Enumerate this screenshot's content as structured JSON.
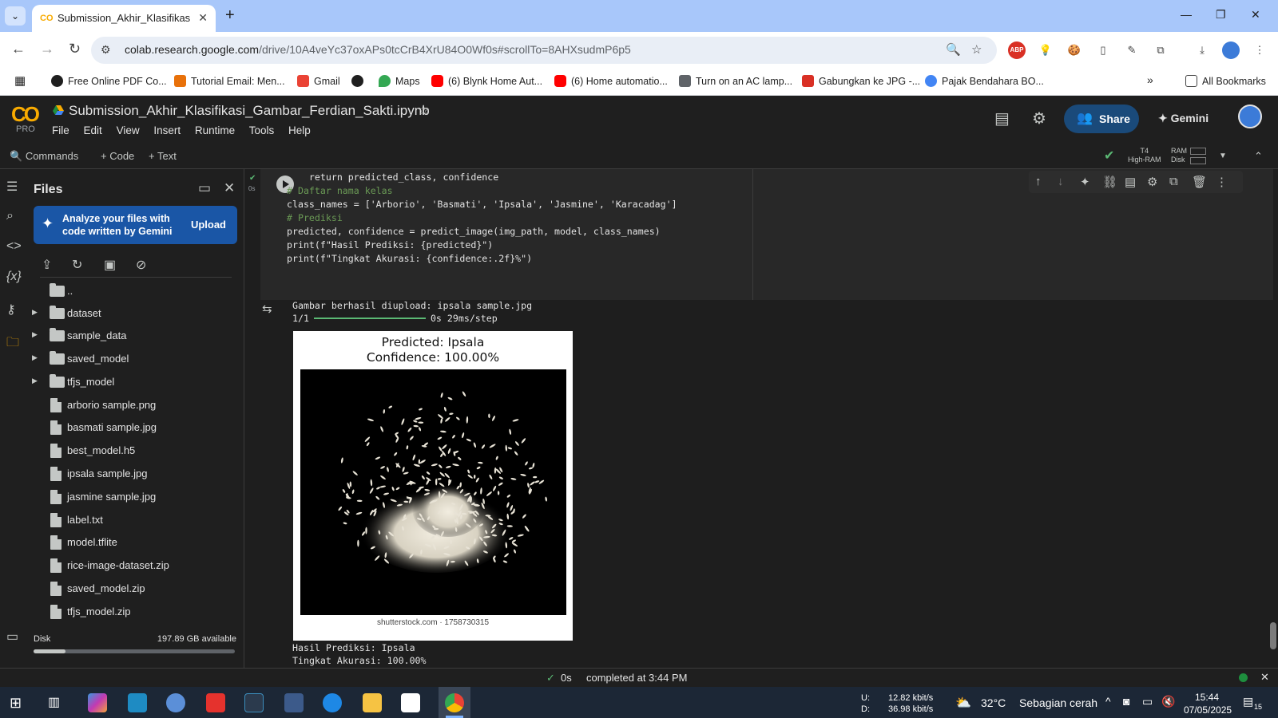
{
  "browser": {
    "tab_title": "Submission_Akhir_Klasifikasi_Ga",
    "url_host": "colab.research.google.com",
    "url_path": "/drive/10A4veYc37oxAPs0tcCrB4XrU84O0Wf0s#scrollTo=8AHXsudmP6p5",
    "bookmarks": [
      {
        "label": "Free Online PDF Co...",
        "color": "#1f1f1f"
      },
      {
        "label": "Tutorial Email: Men...",
        "color": "#e8710a"
      },
      {
        "label": "Gmail",
        "color": "#ea4335"
      },
      {
        "label": "",
        "color": "#1f1f1f"
      },
      {
        "label": "Maps",
        "color": "#34a853"
      },
      {
        "label": "(6) Blynk Home Aut...",
        "color": "#ff0000"
      },
      {
        "label": "(6) Home automatio...",
        "color": "#ff0000"
      },
      {
        "label": "Turn on an AC lamp...",
        "color": "#5f6368"
      },
      {
        "label": "Gabungkan ke JPG -...",
        "color": "#d93025"
      },
      {
        "label": "Pajak Bendahara BO...",
        "color": "#4285f4"
      }
    ],
    "all_bookmarks": "All Bookmarks"
  },
  "colab": {
    "logo": "CO",
    "tier": "PRO",
    "notebook_title": "Submission_Akhir_Klasifikasi_Gambar_Ferdian_Sakti.ipynb",
    "menu": [
      "File",
      "Edit",
      "View",
      "Insert",
      "Runtime",
      "Tools",
      "Help"
    ],
    "share_label": "Share",
    "gemini_label": "Gemini",
    "commands_label": "Commands",
    "code_label": "+ Code",
    "text_label": "+ Text",
    "runtime_gpu": "T4",
    "runtime_type": "High-RAM",
    "ram_label": "RAM",
    "disk_label": "Disk"
  },
  "files_panel": {
    "title": "Files",
    "gemini_prompt": "Analyze your files with code written by Gemini",
    "upload_label": "Upload",
    "items": [
      {
        "label": "..",
        "type": "parent"
      },
      {
        "label": "dataset",
        "type": "folder"
      },
      {
        "label": "sample_data",
        "type": "folder"
      },
      {
        "label": "saved_model",
        "type": "folder"
      },
      {
        "label": "tfjs_model",
        "type": "folder"
      },
      {
        "label": "arborio sample.png",
        "type": "file"
      },
      {
        "label": "basmati sample.jpg",
        "type": "file"
      },
      {
        "label": "best_model.h5",
        "type": "file"
      },
      {
        "label": "ipsala sample.jpg",
        "type": "file"
      },
      {
        "label": "jasmine sample.jpg",
        "type": "file"
      },
      {
        "label": "label.txt",
        "type": "file"
      },
      {
        "label": "model.tflite",
        "type": "file"
      },
      {
        "label": "rice-image-dataset.zip",
        "type": "file"
      },
      {
        "label": "saved_model.zip",
        "type": "file"
      },
      {
        "label": "tfjs_model.zip",
        "type": "file"
      }
    ],
    "disk_label": "Disk",
    "disk_available": "197.89 GB available",
    "disk_used_fraction": 0.16
  },
  "cell": {
    "exec_time": "0s",
    "code_lines": [
      "    return predicted_class, confidence",
      "",
      "# Daftar nama kelas",
      "class_names = ['Arborio', 'Basmati', 'Ipsala', 'Jasmine', 'Karacadag']",
      "",
      "# Prediksi",
      "predicted, confidence = predict_image(img_path, model, class_names)",
      "print(f\"Hasil Prediksi: {predicted}\")",
      "print(f\"Tingkat Akurasi: {confidence:.2f}%\")"
    ],
    "output_upload": "Gambar berhasil diupload: ipsala sample.jpg",
    "output_step_count": "1/1",
    "output_step_time": "0s 29ms/step",
    "figure_title_1": "Predicted: Ipsala",
    "figure_title_2": "Confidence: 100.00%",
    "figure_caption": "shutterstock.com · 1758730315",
    "output_result_1": "Hasil Prediksi: Ipsala",
    "output_result_2": "Tingkat Akurasi: 100.00%"
  },
  "status": {
    "exec_time": "0s",
    "completed": "completed at 3:44 PM"
  },
  "taskbar": {
    "net_up_label": "U:",
    "net_up": "12.82 kbit/s",
    "net_down_label": "D:",
    "net_down": "36.98 kbit/s",
    "temperature": "32°C",
    "weather": "Sebagian cerah",
    "time": "15:44",
    "date": "07/05/2025",
    "notifications": "15"
  }
}
